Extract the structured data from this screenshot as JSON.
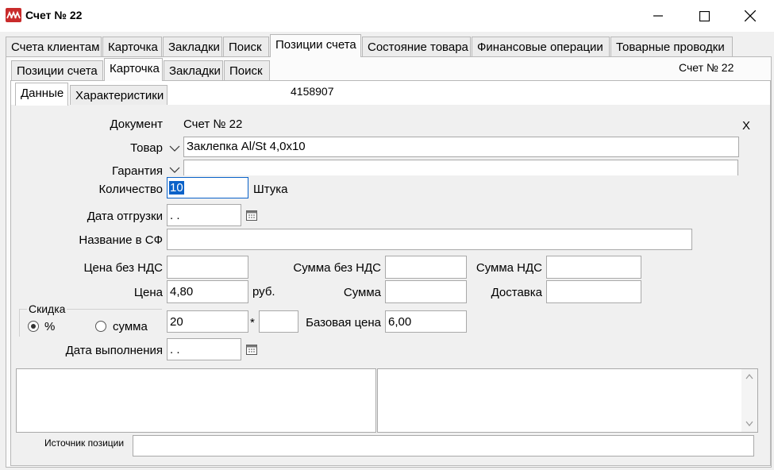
{
  "window": {
    "title": "Счет № 22",
    "minimize_icon": "minimize-icon",
    "maximize_icon": "maximize-icon",
    "close_icon": "close-icon"
  },
  "top_tabs": [
    {
      "label": "Счета клиентам"
    },
    {
      "label": "Карточка"
    },
    {
      "label": "Закладки"
    },
    {
      "label": "Поиск"
    },
    {
      "label": "Позиции счета",
      "active": true
    },
    {
      "label": "Состояние товара"
    },
    {
      "label": "Финансовые операции"
    },
    {
      "label": "Товарные проводки"
    }
  ],
  "sub_tabs": [
    {
      "label": "Позиции счета"
    },
    {
      "label": "Карточка",
      "active": true
    },
    {
      "label": "Закладки"
    },
    {
      "label": "Поиск"
    }
  ],
  "header_right": "Счет № 22",
  "inner_tabs": [
    {
      "label": "Данные",
      "active": true
    },
    {
      "label": "Характеристики"
    }
  ],
  "record_id": "4158907",
  "form": {
    "document_label": "Документ",
    "document_value": "Счет № 22",
    "clear_x": "X",
    "product_label": "Товар",
    "product_value": "Заклепка Al/St 4,0x10",
    "warranty_label": "Гарантия",
    "warranty_value": "",
    "quantity_label": "Количество",
    "quantity_value": "10",
    "unit": "Штука",
    "ship_date_label": "Дата отгрузки",
    "ship_date_value": " .  .",
    "invoice_name_label": "Название в СФ",
    "invoice_name_value": "",
    "price_no_vat_label": "Цена без НДС",
    "price_no_vat_value": "",
    "sum_no_vat_label": "Сумма без НДС",
    "sum_no_vat_value": "",
    "vat_sum_label": "Сумма НДС",
    "vat_sum_value": "",
    "price_label": "Цена",
    "price_value": "4,80",
    "currency": "руб.",
    "sum_label": "Сумма",
    "sum_value": "",
    "delivery_label": "Доставка",
    "delivery_value": "",
    "discount_group": "Скидка",
    "discount_percent_label": "%",
    "discount_amount_label": "сумма",
    "discount_value": "20",
    "multiply_sign": "*",
    "multiplier_value": "",
    "base_price_label": "Базовая цена",
    "base_price_value": "6,00",
    "done_date_label": "Дата выполнения",
    "done_date_value": " .  .",
    "source_label": "Источник позиции",
    "source_value": ""
  }
}
